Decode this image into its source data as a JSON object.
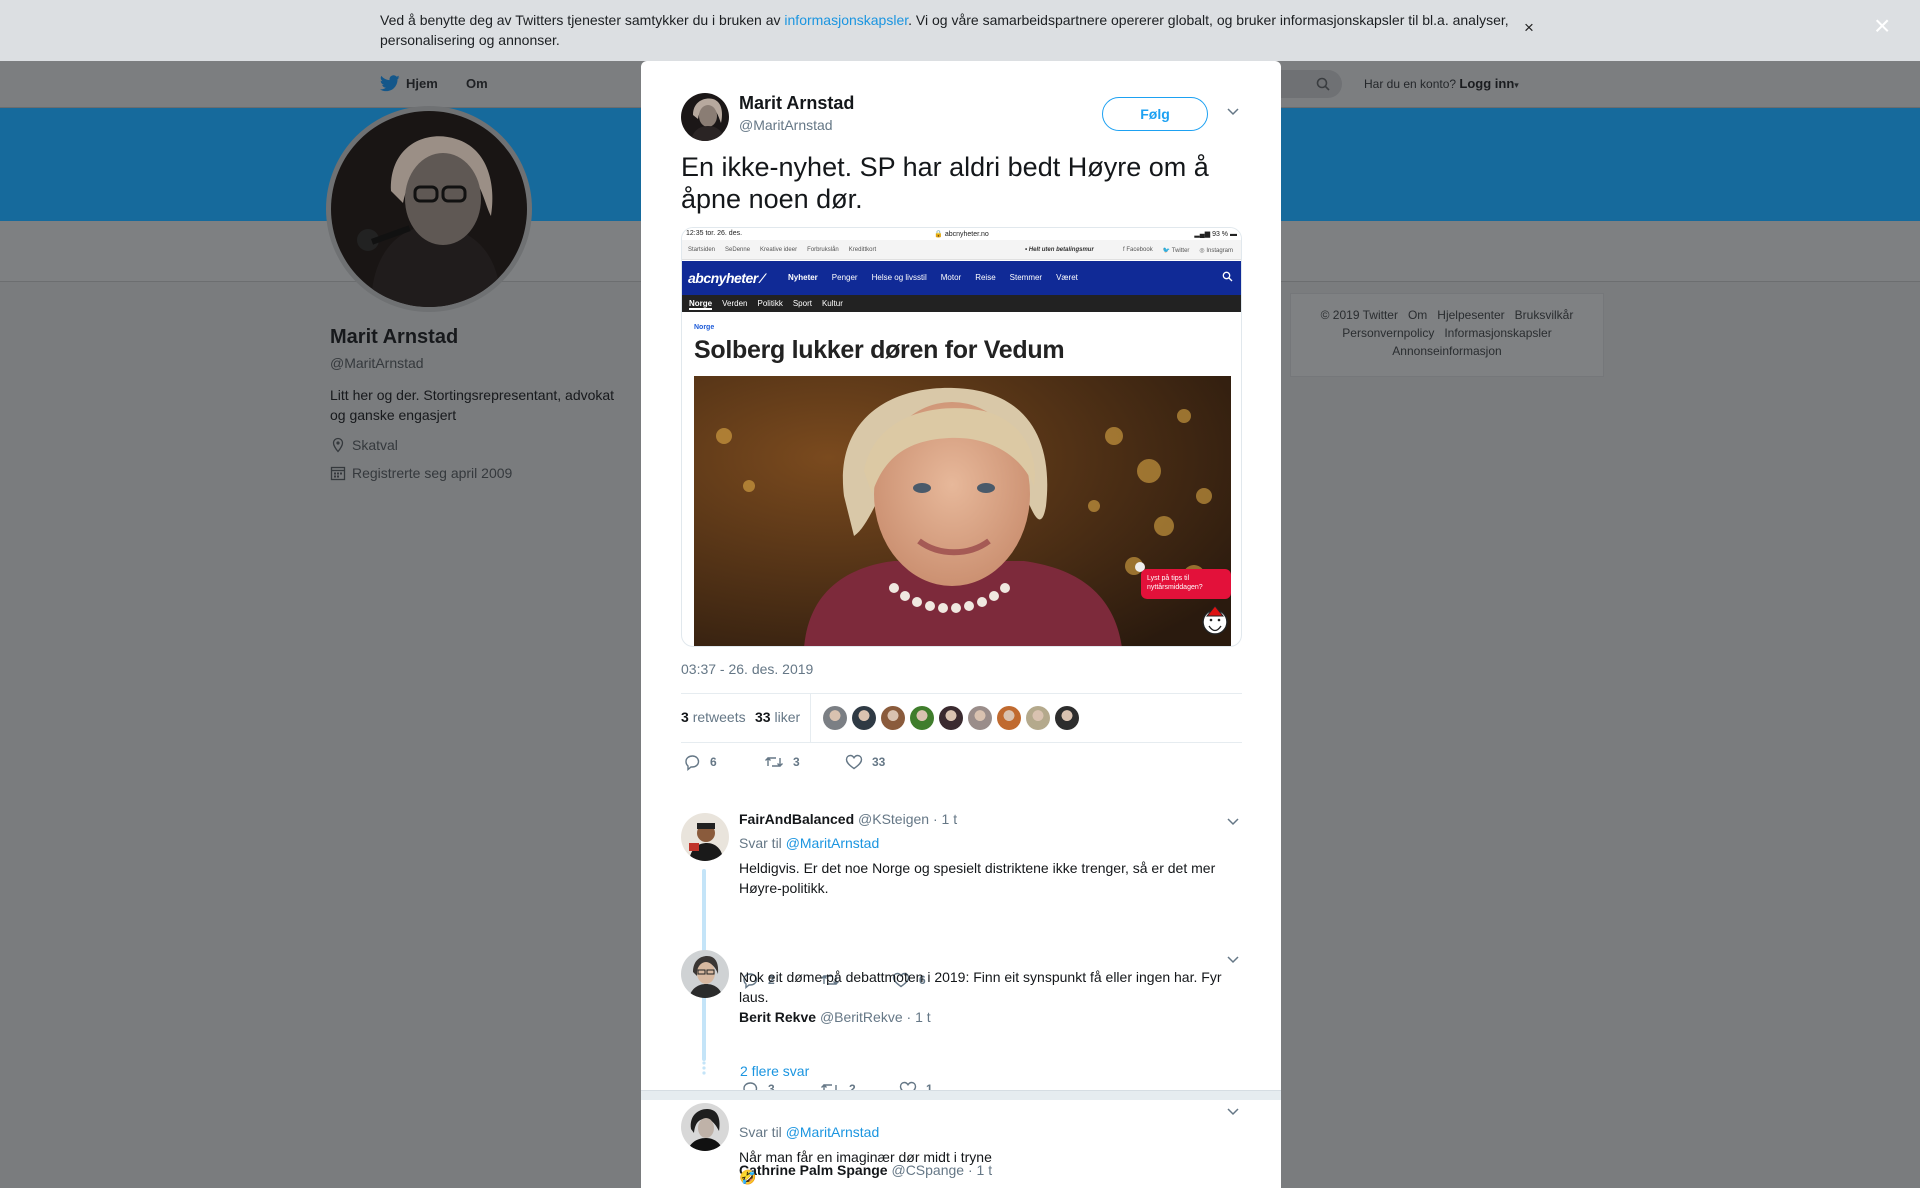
{
  "cookie_bar": {
    "text_before": "Ved å benytte deg av Twitters tjenester samtykker du i bruken av ",
    "link": "informasjonskapsler",
    "text_after": ". Vi og våre samarbeidspartnere opererer globalt, og bruker informasjonskapsler til bl.a. analyser, personalisering og annonser.",
    "close": "×"
  },
  "topnav": {
    "home": "Hjem",
    "about": "Om",
    "login_prompt": "Har du en konto?",
    "login": "Logg inn"
  },
  "profile": {
    "name": "Marit Arnstad",
    "handle": "@MaritArnstad",
    "bio": "Litt her og der. Stortingsrepresentant, advokat og ganske engasjert",
    "location": "Skatval",
    "joined": "Registrerte seg april 2009"
  },
  "footer": {
    "row1": [
      "© 2019 Twitter",
      "Om",
      "Hjelpesenter",
      "Bruksvilkår"
    ],
    "row2": [
      "Personvernpolicy",
      "Informasjonskapsler"
    ],
    "row3": [
      "Annonseinformasjon"
    ]
  },
  "modal": {
    "close": "×",
    "author_name": "Marit Arnstad",
    "author_handle": "@MaritArnstad",
    "follow": "Følg",
    "text": "En ikke-nyhet. SP har aldri bedt Høyre om å åpne noen dør.",
    "date": "03:37 - 26. des. 2019",
    "retweets_count": "3",
    "retweets_label": "retweets",
    "likes_count": "33",
    "likes_label": "liker",
    "liker_colors": [
      "#7b7f84",
      "#2f3a44",
      "#8a5b3c",
      "#3f7d2c",
      "#3a2a2f",
      "#9a8d8a",
      "#c06a2f",
      "#b4a98c",
      "#2d2d2d"
    ],
    "actions": {
      "replies": "6",
      "retweets": "3",
      "likes": "33"
    }
  },
  "screenshot": {
    "status_time": "12:35  tor. 26. des.",
    "status_url": "abcnyheter.no",
    "status_battery": "93 %",
    "bookmarks": [
      "Startsiden",
      "SeDenne",
      "Kreative ideer",
      "Forbrukslån",
      "Kredittkort"
    ],
    "bookmark_ad": "• Helt uten betalingsmur",
    "social": [
      "Facebook",
      "Twitter",
      "Instagram"
    ],
    "logo": "abcnyheter",
    "nav": [
      "Nyheter",
      "Penger",
      "Helse og livsstil",
      "Motor",
      "Reise",
      "Stemmer",
      "Været"
    ],
    "subnav": [
      "Norge",
      "Verden",
      "Politikk",
      "Sport",
      "Kultur"
    ],
    "category": "Norge",
    "headline": "Solberg lukker døren for Vedum",
    "bubble": "Lyst på tips til nyttårsmiddagen?"
  },
  "replies": [
    {
      "name": "FairAndBalanced",
      "handle": "@KSteigen",
      "time": "· 1 t",
      "reply_prefix": "Svar til",
      "reply_to": "@MaritArnstad",
      "text": "Heldigvis. Er det noe Norge og spesielt distriktene ikke trenger, så er det mer Høyre-politikk.",
      "replies": "2",
      "retweets": "",
      "likes": "6"
    },
    {
      "name": "Berit Rekve",
      "handle": "@BeritRekve",
      "time": "· 1 t",
      "text": "Nok eit døme på debattmoten i 2019: Finn eit synspunkt få eller ingen har. Fyr laus.",
      "replies": "3",
      "retweets": "2",
      "likes": "1"
    },
    {
      "name": "Cathrine Palm Spange",
      "handle": "@CSpange",
      "time": "· 1 t",
      "reply_prefix": "Svar til",
      "reply_to": "@MaritArnstad",
      "text": "Når man får en imaginær dør midt i tryne",
      "emoji": "🤣"
    }
  ],
  "more_replies": "2 flere svar"
}
